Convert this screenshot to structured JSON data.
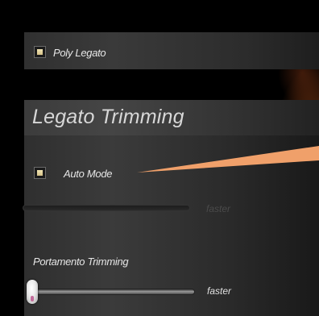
{
  "poly_legato": {
    "label": "Poly Legato",
    "checked": true
  },
  "legato_trimming": {
    "title": "Legato Trimming",
    "auto_mode": {
      "label": "Auto Mode",
      "checked": true
    },
    "trim_slider": {
      "end_label": "faster",
      "enabled": false
    }
  },
  "portamento_trimming": {
    "label": "Portamento Trimming",
    "slider": {
      "end_label": "faster",
      "value": 0.0
    }
  },
  "colors": {
    "checkbox_fill": "#e8dba4",
    "callout": "#f0a06a",
    "panel": "#363636",
    "knob_tip": "#c26b9a"
  }
}
